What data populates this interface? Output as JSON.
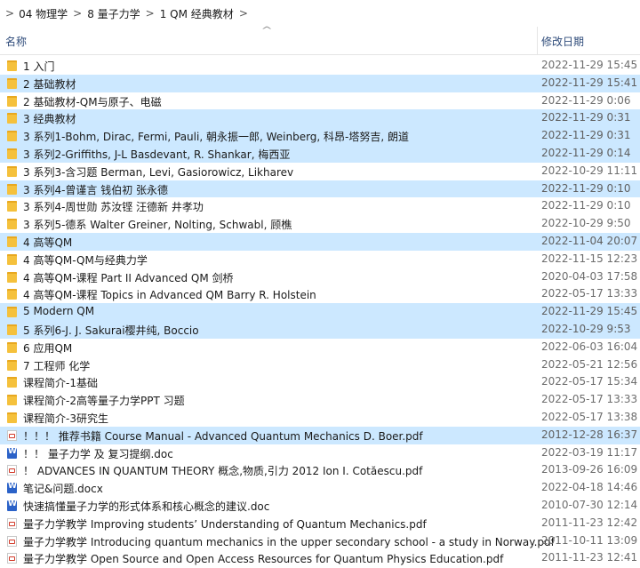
{
  "breadcrumb": {
    "items": [
      "04 物理学",
      "8 量子力学",
      "1 QM  经典教材"
    ],
    "separator": ">"
  },
  "header": {
    "name_label": "名称",
    "date_label": "修改日期",
    "sort_arrow": "^"
  },
  "rows": [
    {
      "icon": "folder-icon",
      "name": "1 入门",
      "date": "2022-11-29 15:45",
      "selected": false
    },
    {
      "icon": "folder-icon",
      "name": "2 基础教材",
      "date": "2022-11-29 15:41",
      "selected": true
    },
    {
      "icon": "folder-icon",
      "name": "2 基础教材-QM与原子、电磁",
      "date": "2022-11-29 0:06",
      "selected": false
    },
    {
      "icon": "folder-icon",
      "name": "3 经典教材",
      "date": "2022-11-29 0:31",
      "selected": true
    },
    {
      "icon": "folder-icon",
      "name": "3 系列1-Bohm, Dirac, Fermi, Pauli, 朝永振一郎, Weinberg, 科昂-塔努吉, 朗道",
      "date": "2022-11-29 0:31",
      "selected": true
    },
    {
      "icon": "folder-icon",
      "name": "3 系列2-Griffiths, J-L Basdevant, R. Shankar, 梅西亚",
      "date": "2022-11-29 0:14",
      "selected": true
    },
    {
      "icon": "folder-icon",
      "name": "3 系列3-含习题 Berman, Levi, Gasiorowicz, Likharev",
      "date": "2022-10-29 11:11",
      "selected": false
    },
    {
      "icon": "folder-icon",
      "name": "3 系列4-曾谨言 钱伯初 张永德",
      "date": "2022-11-29 0:10",
      "selected": true
    },
    {
      "icon": "folder-icon",
      "name": "3 系列4-周世勋 苏汝铿 汪德新 井孝功",
      "date": "2022-11-29 0:10",
      "selected": false
    },
    {
      "icon": "folder-icon",
      "name": "3 系列5-德系 Walter Greiner, Nolting, Schwabl, 顾樵",
      "date": "2022-10-29 9:50",
      "selected": false
    },
    {
      "icon": "folder-icon",
      "name": "4 高等QM",
      "date": "2022-11-04 20:07",
      "selected": true
    },
    {
      "icon": "folder-icon",
      "name": "4 高等QM-QM与经典力学",
      "date": "2022-11-15 12:23",
      "selected": false
    },
    {
      "icon": "folder-icon",
      "name": "4 高等QM-课程 Part II Advanced QM 剑桥",
      "date": "2020-04-03 17:58",
      "selected": false
    },
    {
      "icon": "folder-icon",
      "name": "4 高等QM-课程 Topics in Advanced QM Barry R. Holstein",
      "date": "2022-05-17 13:33",
      "selected": false
    },
    {
      "icon": "folder-icon",
      "name": "5 Modern QM",
      "date": "2022-11-29 15:45",
      "selected": true
    },
    {
      "icon": "folder-icon",
      "name": "5 系列6-J. J. Sakurai樱井纯, Boccio",
      "date": "2022-10-29 9:53",
      "selected": true
    },
    {
      "icon": "folder-icon",
      "name": "6 应用QM",
      "date": "2022-06-03 16:04",
      "selected": false
    },
    {
      "icon": "folder-icon",
      "name": "7 工程师 化学",
      "date": "2022-05-21 12:56",
      "selected": false
    },
    {
      "icon": "folder-icon",
      "name": "课程简介-1基础",
      "date": "2022-05-17 15:34",
      "selected": false
    },
    {
      "icon": "folder-icon",
      "name": "课程简介-2高等量子力学PPT 习题",
      "date": "2022-05-17 13:33",
      "selected": false
    },
    {
      "icon": "folder-icon",
      "name": "课程简介-3研究生",
      "date": "2022-05-17 13:38",
      "selected": false
    },
    {
      "icon": "pdf-icon",
      "name": "！！！ 推荐书籍 Course Manual - Advanced Quantum Mechanics   D. Boer.pdf",
      "date": "2012-12-28 16:37",
      "selected": true
    },
    {
      "icon": "doc-icon",
      "name": "！！ 量子力学 及 复习提纲.doc",
      "date": "2022-03-19 11:17",
      "selected": false
    },
    {
      "icon": "pdf-icon",
      "name": "！ ADVANCES IN QUANTUM THEORY 概念,物质,引力 2012 Ion I. Cotăescu.pdf",
      "date": "2013-09-26 16:09",
      "selected": false
    },
    {
      "icon": "doc-icon",
      "name": "笔记&问题.docx",
      "date": "2022-04-18 14:46",
      "selected": false
    },
    {
      "icon": "doc-icon",
      "name": "快速搞懂量子力学的形式体系和核心概念的建议.doc",
      "date": "2010-07-30 12:14",
      "selected": false
    },
    {
      "icon": "pdf-icon",
      "name": "量子力学教学 Improving students’ Understanding of Quantum Mechanics.pdf",
      "date": "2011-11-23 12:42",
      "selected": false
    },
    {
      "icon": "pdf-icon",
      "name": "量子力学教学 Introducing quantum mechanics in the upper secondary school - a study in Norway.pdf",
      "date": "2011-10-11 13:09",
      "selected": false
    },
    {
      "icon": "pdf-icon",
      "name": "量子力学教学 Open Source and Open Access Resources for Quantum Physics Education.pdf",
      "date": "2011-11-23 12:41",
      "selected": false
    }
  ]
}
